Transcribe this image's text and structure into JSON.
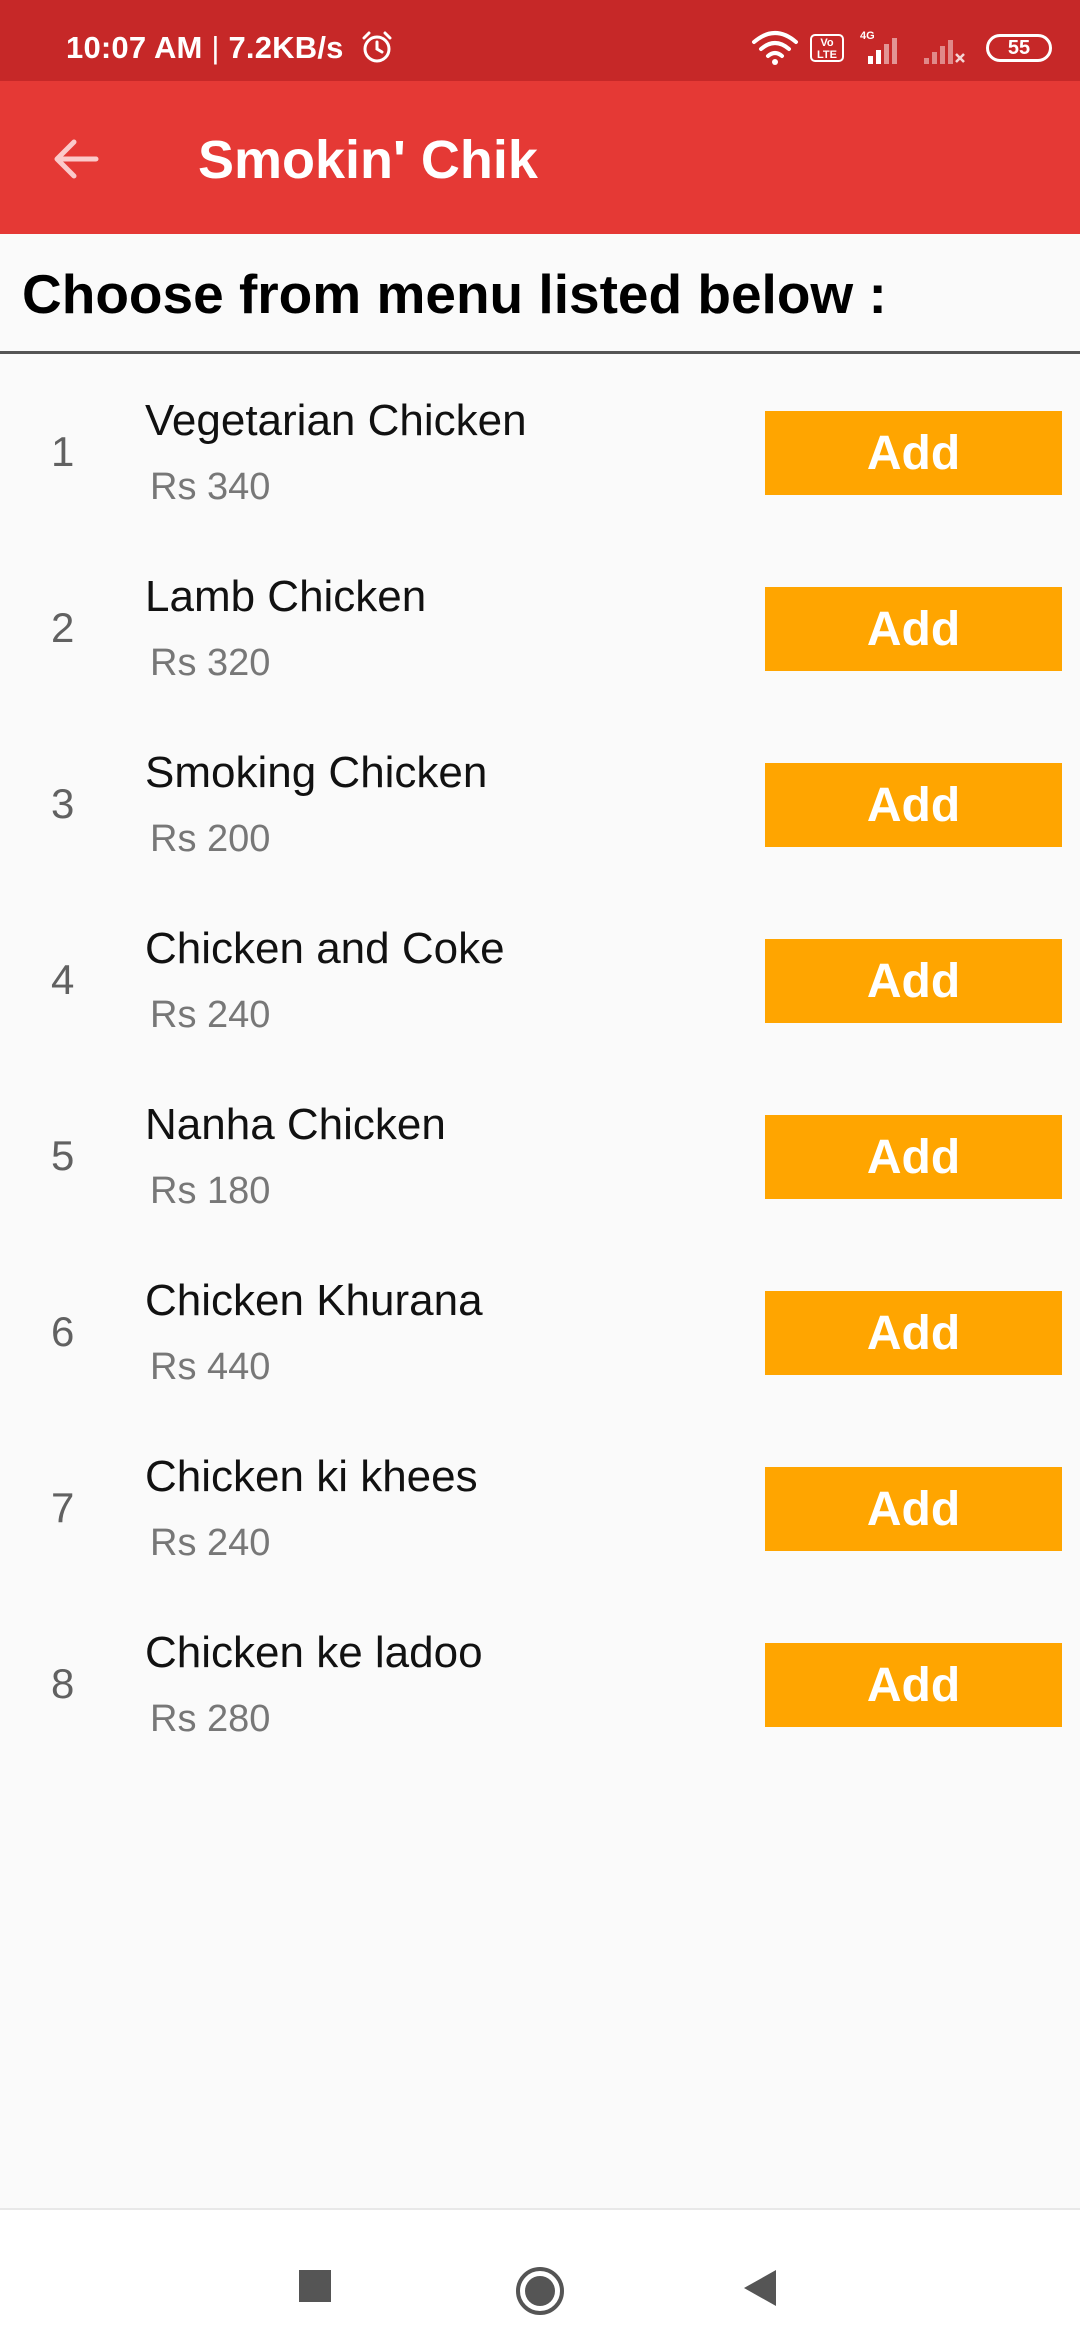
{
  "status_bar": {
    "time": "10:07 AM",
    "separator": " | ",
    "net_speed": "7.2KB/s",
    "volte_label": "Vo LTE",
    "network_type": "4G",
    "battery": "55"
  },
  "app_bar": {
    "title": "Smokin' Chik"
  },
  "menu": {
    "header": "Choose from menu listed below :",
    "add_label": "Add",
    "items": [
      {
        "index": "1",
        "name": "Vegetarian Chicken",
        "price": "Rs 340"
      },
      {
        "index": "2",
        "name": "Lamb Chicken",
        "price": "Rs 320"
      },
      {
        "index": "3",
        "name": "Smoking Chicken",
        "price": "Rs 200"
      },
      {
        "index": "4",
        "name": "Chicken and Coke",
        "price": "Rs 240"
      },
      {
        "index": "5",
        "name": "Nanha Chicken",
        "price": "Rs 180"
      },
      {
        "index": "6",
        "name": "Chicken Khurana",
        "price": "Rs 440"
      },
      {
        "index": "7",
        "name": "Chicken ki khees",
        "price": "Rs 240"
      },
      {
        "index": "8",
        "name": "Chicken ke ladoo",
        "price": "Rs 280"
      }
    ]
  },
  "colors": {
    "status_bar": "#c62828",
    "app_bar": "#e53935",
    "add_button": "#ffa500",
    "background": "#fafafa"
  },
  "icons": {
    "alarm": "alarm-icon",
    "wifi": "wifi-icon",
    "signal": "signal-icon",
    "battery": "battery-icon",
    "back": "arrow-back-icon",
    "nav_recent": "square-icon",
    "nav_home": "circle-icon",
    "nav_back": "triangle-back-icon"
  }
}
